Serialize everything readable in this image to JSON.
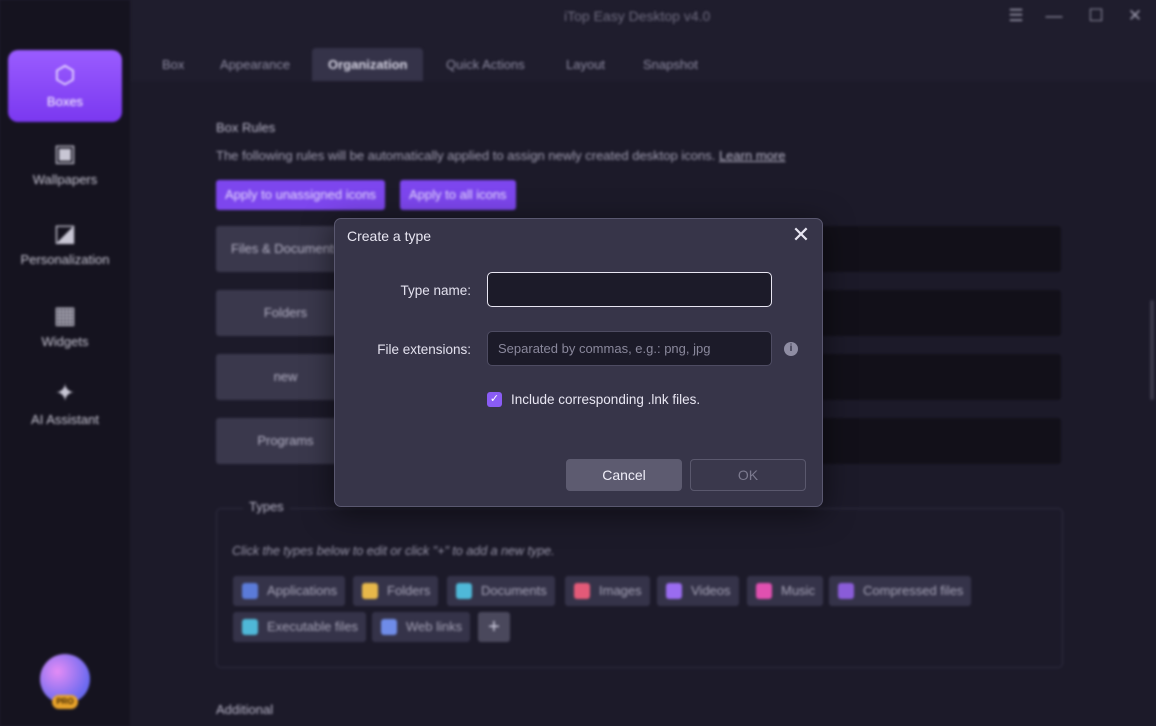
{
  "app": {
    "title": "iTop Easy Desktop v4.0"
  },
  "window_controls": {
    "menu": "☰",
    "minimize": "—",
    "maximize": "☐",
    "close": "✕"
  },
  "sidebar": {
    "items": [
      {
        "label": "Boxes",
        "icon": "cube-icon",
        "glyph": "⬡"
      },
      {
        "label": "Wallpapers",
        "icon": "wallpaper-icon",
        "glyph": "▣"
      },
      {
        "label": "Personalization",
        "icon": "personalization-icon",
        "glyph": "◪"
      },
      {
        "label": "Widgets",
        "icon": "widgets-icon",
        "glyph": "▦"
      },
      {
        "label": "AI Assistant",
        "icon": "ai-assistant-icon",
        "glyph": "✦"
      }
    ],
    "pro_badge": "PRO"
  },
  "tabs": [
    "Box",
    "Appearance",
    "Organization",
    "Quick Actions",
    "Layout",
    "Snapshot"
  ],
  "box_rules": {
    "title": "Box Rules",
    "description": "The following rules will be automatically applied to assign newly created desktop icons.",
    "learn_more": "Learn more",
    "apply_unassigned": "Apply to unassigned icons",
    "apply_all": "Apply to all icons",
    "rows": [
      "Files & Documents",
      "Folders",
      "new",
      "Programs"
    ]
  },
  "types": {
    "legend": "Types",
    "hint": "Click the types below to edit or click \"+\" to add a new type.",
    "chips": [
      {
        "label": "Applications",
        "color": "#5b7bd8"
      },
      {
        "label": "Folders",
        "color": "#e7b84a"
      },
      {
        "label": "Documents",
        "color": "#4fb8d8"
      },
      {
        "label": "Images",
        "color": "#e35a78"
      },
      {
        "label": "Videos",
        "color": "#9a6cf0"
      },
      {
        "label": "Music",
        "color": "#e050b0"
      },
      {
        "label": "Compressed files",
        "color": "#8a5cd8"
      },
      {
        "label": "Executable files",
        "color": "#4fb8d8"
      },
      {
        "label": "Web links",
        "color": "#6f8ce8"
      }
    ],
    "add": "+"
  },
  "additional": "Additional",
  "dialog": {
    "title": "Create a type",
    "close": "✕",
    "type_name_label": "Type name:",
    "type_name_value": "",
    "file_ext_label": "File extensions:",
    "file_ext_placeholder": "Separated by commas, e.g.: png, jpg",
    "info": "i",
    "include_lnk_label": "Include corresponding .lnk files.",
    "include_lnk_checked": true,
    "cancel": "Cancel",
    "ok": "OK"
  }
}
